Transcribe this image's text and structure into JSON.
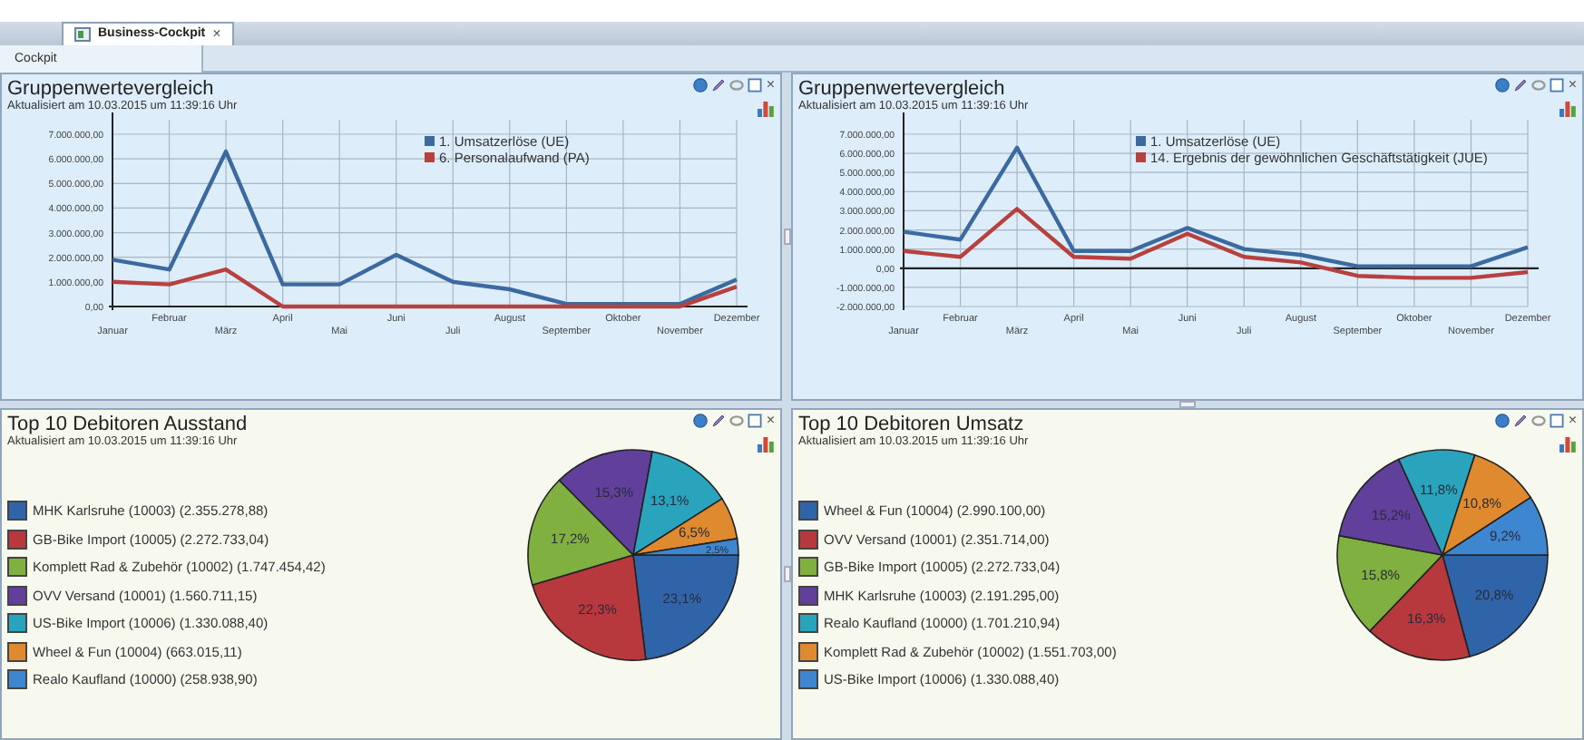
{
  "tabs": [
    {
      "label": "Business-Cockpit",
      "selected": true,
      "close": "×"
    }
  ],
  "subtabs": [
    {
      "label": "Cockpit",
      "selected": true
    }
  ],
  "panels": [
    {
      "kind": "line",
      "title": "Gruppenwertevergleich",
      "updated": "Aktualisiert am 10.03.2015 um 11:39:16 Uhr",
      "close": "×",
      "chart_data": {
        "type": "line",
        "categories": [
          "Januar",
          "Februar",
          "März",
          "April",
          "Mai",
          "Juni",
          "Juli",
          "August",
          "September",
          "Oktober",
          "November",
          "Dezember"
        ],
        "ylim": [
          0,
          7000000
        ],
        "yticks": [
          {
            "value": 0,
            "label": "0,00"
          },
          {
            "value": 1000000,
            "label": "1.000.000,00"
          },
          {
            "value": 2000000,
            "label": "2.000.000,00"
          },
          {
            "value": 3000000,
            "label": "3.000.000,00"
          },
          {
            "value": 4000000,
            "label": "4.000.000,00"
          },
          {
            "value": 5000000,
            "label": "5.000.000,00"
          },
          {
            "value": 6000000,
            "label": "6.000.000,00"
          },
          {
            "value": 7000000,
            "label": "7.000.000,00"
          }
        ],
        "grid": true,
        "legend": true,
        "series": [
          {
            "name": "1. Umsatzerlöse (UE)",
            "color": "#3b6aa0",
            "values": [
              1900000,
              1500000,
              6300000,
              900000,
              900000,
              2100000,
              1000000,
              700000,
              100000,
              100000,
              100000,
              1100000
            ]
          },
          {
            "name": "6. Personalaufwand (PA)",
            "color": "#b8413f",
            "values": [
              1000000,
              900000,
              1500000,
              0,
              0,
              0,
              0,
              0,
              0,
              0,
              0,
              800000
            ]
          }
        ]
      }
    },
    {
      "kind": "line",
      "title": "Gruppenwertevergleich",
      "updated": "Aktualisiert am 10.03.2015 um 11:39:16 Uhr",
      "close": "×",
      "chart_data": {
        "type": "line",
        "categories": [
          "Januar",
          "Februar",
          "März",
          "April",
          "Mai",
          "Juni",
          "Juli",
          "August",
          "September",
          "Oktober",
          "November",
          "Dezember"
        ],
        "ylim": [
          -2000000,
          7000000
        ],
        "yticks": [
          {
            "value": -2000000,
            "label": "-2.000.000,00"
          },
          {
            "value": -1000000,
            "label": "-1.000.000,00"
          },
          {
            "value": 0,
            "label": "0,00"
          },
          {
            "value": 1000000,
            "label": "1.000.000,00"
          },
          {
            "value": 2000000,
            "label": "2.000.000,00"
          },
          {
            "value": 3000000,
            "label": "3.000.000,00"
          },
          {
            "value": 4000000,
            "label": "4.000.000,00"
          },
          {
            "value": 5000000,
            "label": "5.000.000,00"
          },
          {
            "value": 6000000,
            "label": "6.000.000,00"
          },
          {
            "value": 7000000,
            "label": "7.000.000,00"
          }
        ],
        "grid": true,
        "legend": true,
        "series": [
          {
            "name": "1. Umsatzerlöse (UE)",
            "color": "#3b6aa0",
            "values": [
              1900000,
              1500000,
              6300000,
              900000,
              900000,
              2100000,
              1000000,
              700000,
              100000,
              100000,
              100000,
              1100000
            ]
          },
          {
            "name": "14. Ergebnis der gewöhnlichen Geschäftstätigkeit (JUE)",
            "color": "#b8413f",
            "values": [
              900000,
              600000,
              3100000,
              600000,
              500000,
              1800000,
              600000,
              300000,
              -400000,
              -500000,
              -500000,
              -200000
            ]
          }
        ]
      }
    },
    {
      "kind": "pie",
      "title": "Top 10 Debitoren Ausstand",
      "updated": "Aktualisiert am 10.03.2015 um 11:39:16 Uhr",
      "close": "×",
      "legend": [
        {
          "label": "MHK Karlsruhe (10003) (2.355.278,88)",
          "color": "#2f64a8"
        },
        {
          "label": "GB-Bike Import (10005) (2.272.733,04)",
          "color": "#b7383d"
        },
        {
          "label": "Komplett Rad & Zubehör (10002) (1.747.454,42)",
          "color": "#80b040"
        },
        {
          "label": "OVV Versand (10001) (1.560.711,15)",
          "color": "#60409a"
        },
        {
          "label": "US-Bike Import (10006) (1.330.088,40)",
          "color": "#2aa3bd"
        },
        {
          "label": "Wheel & Fun (10004) (663.015,11)",
          "color": "#df8a2e"
        },
        {
          "label": "Realo Kaufland (10000) (258.938,90)",
          "color": "#3f86d0"
        }
      ],
      "chart_data": {
        "type": "pie",
        "values": [
          23.1,
          22.3,
          17.2,
          15.3,
          13.1,
          6.5,
          2.5
        ],
        "value_labels": [
          "23,1%",
          "22,3%",
          "17,2%",
          "15,3%",
          "13,1%",
          "6,5%",
          "2,5%"
        ]
      }
    },
    {
      "kind": "pie",
      "title": "Top 10 Debitoren Umsatz",
      "updated": "Aktualisiert am 10.03.2015 um 11:39:16 Uhr",
      "close": "×",
      "legend": [
        {
          "label": "Wheel & Fun (10004) (2.990.100,00)",
          "color": "#2f64a8"
        },
        {
          "label": "OVV Versand (10001) (2.351.714,00)",
          "color": "#b7383d"
        },
        {
          "label": "GB-Bike Import (10005) (2.272.733,04)",
          "color": "#80b040"
        },
        {
          "label": "MHK Karlsruhe (10003) (2.191.295,00)",
          "color": "#60409a"
        },
        {
          "label": "Realo Kaufland (10000) (1.701.210,94)",
          "color": "#2aa3bd"
        },
        {
          "label": "Komplett Rad & Zubehör (10002) (1.551.703,00)",
          "color": "#df8a2e"
        },
        {
          "label": "US-Bike Import (10006) (1.330.088,40)",
          "color": "#3f86d0"
        }
      ],
      "chart_data": {
        "type": "pie",
        "values": [
          20.8,
          16.3,
          15.8,
          15.2,
          11.8,
          10.8,
          9.2
        ],
        "value_labels": [
          "20,8%",
          "16,3%",
          "15,8%",
          "15,2%",
          "11,8%",
          "10,8%",
          "9,2%"
        ]
      }
    }
  ]
}
